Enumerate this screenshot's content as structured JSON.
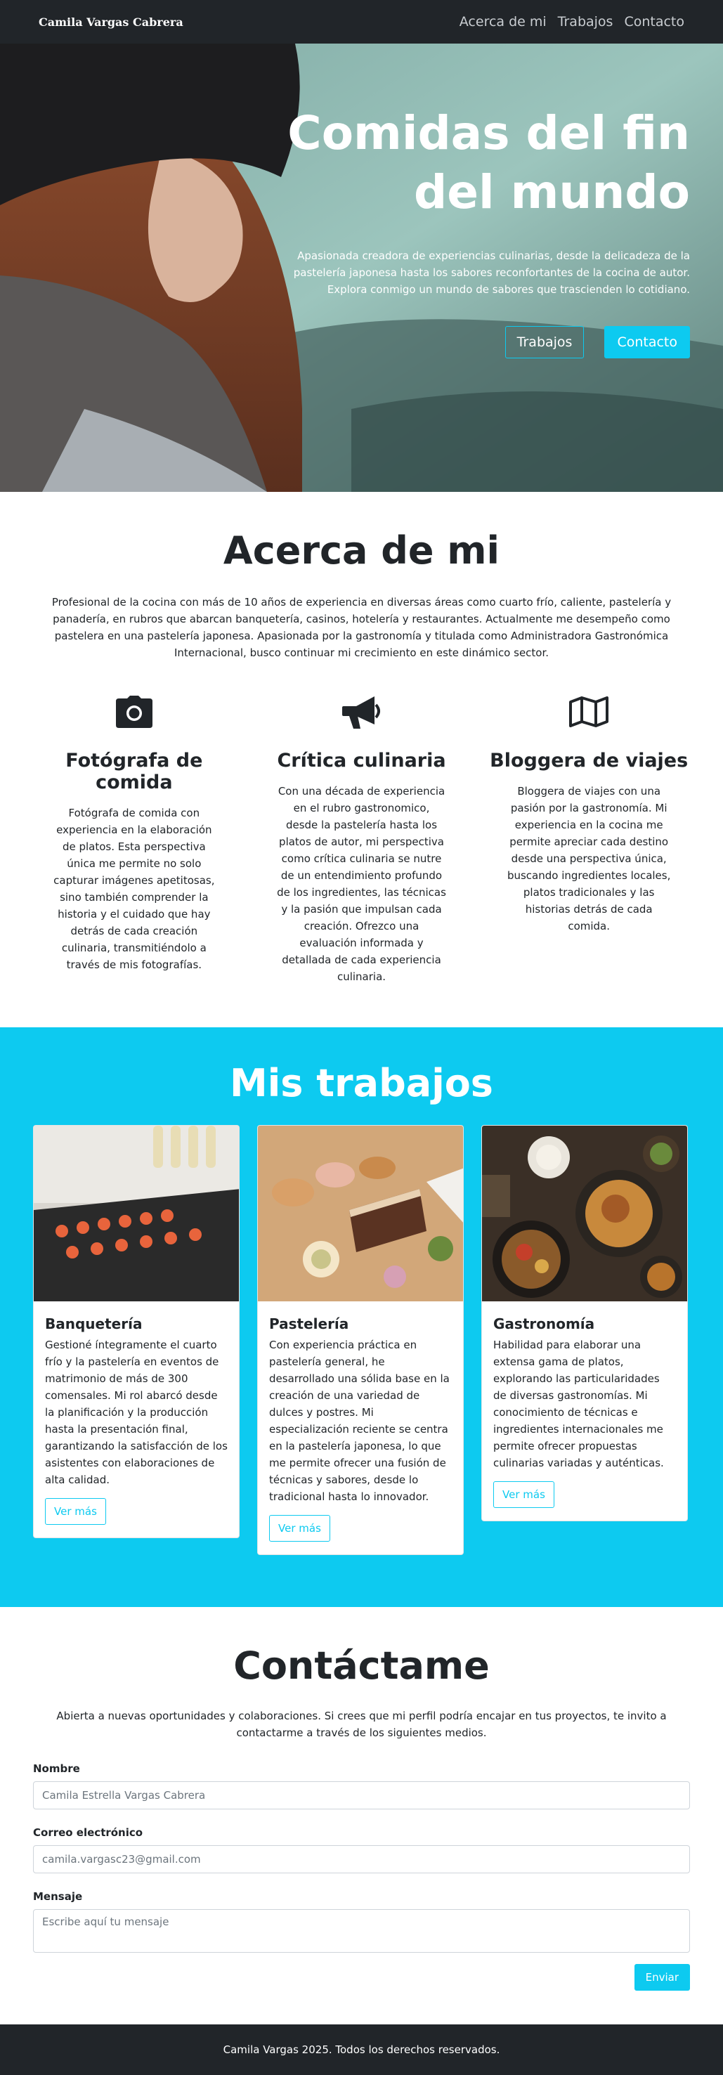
{
  "nav": {
    "brand": "Camila Vargas Cabrera",
    "links": [
      "Acerca de mi",
      "Trabajos",
      "Contacto"
    ]
  },
  "hero": {
    "title_line1": "Comidas del fin",
    "title_line2": "del mundo",
    "text": "Apasionada creadora de experiencias culinarias, desde la delicadeza de la pastelería japonesa hasta los sabores reconfortantes de la cocina de autor. Explora conmigo un mundo de sabores que trascienden lo cotidiano.",
    "btn_works": "Trabajos",
    "btn_contact": "Contacto"
  },
  "about": {
    "title": "Acerca de mi",
    "lead": "Profesional de la cocina con más de 10 años de experiencia en diversas áreas como cuarto frío, caliente, pastelería y panadería, en rubros que abarcan banquetería, casinos, hotelería y restaurantes. Actualmente me desempeño como pastelera en una pastelería japonesa. Apasionada por la gastronomía y titulada como Administradora Gastronómica Internacional, busco continuar mi crecimiento en este dinámico sector.",
    "features": [
      {
        "icon": "camera-icon",
        "title": "Fotógrafa de comida",
        "text": "Fotógrafa de comida con experiencia en la elaboración de platos. Esta perspectiva única me permite no solo capturar imágenes apetitosas, sino también comprender la historia y el cuidado que hay detrás de cada creación culinaria, transmitiéndolo a través de mis fotografías."
      },
      {
        "icon": "megaphone-icon",
        "title": "Crítica culinaria",
        "text": "Con una década de experiencia en el rubro gastronomico, desde la pastelería hasta los platos de autor, mi perspectiva como crítica culinaria se nutre de un entendimiento profundo de los ingredientes, las técnicas y la pasión que impulsan cada creación. Ofrezco una evaluación informada y detallada de cada experiencia culinaria."
      },
      {
        "icon": "map-icon",
        "title": "Bloggera de viajes",
        "text": "Bloggera de viajes con una pasión por la gastronomía. Mi experiencia en la cocina me permite apreciar cada destino desde una perspectiva única, buscando ingredientes locales, platos tradicionales y las historias detrás de cada comida."
      }
    ]
  },
  "works": {
    "title": "Mis trabajos",
    "cards": [
      {
        "title": "Banquetería",
        "text": "Gestioné íntegramente el cuarto frío y la pastelería en eventos de matrimonio de más de 300 comensales. Mi rol abarcó desde la planificación y la producción hasta la presentación final, garantizando la satisfacción de los asistentes con elaboraciones de alta calidad.",
        "button": "Ver más"
      },
      {
        "title": "Pastelería",
        "text": "Con experiencia práctica en pastelería general, he desarrollado una sólida base en la creación de una variedad de dulces y postres. Mi especialización reciente se centra en la pastelería japonesa, lo que me permite ofrecer una fusión de técnicas y sabores, desde lo tradicional hasta lo innovador.",
        "button": "Ver más"
      },
      {
        "title": "Gastronomía",
        "text": "Habilidad para elaborar una extensa gama de platos, explorando las particularidades de diversas gastronomías. Mi conocimiento de técnicas e ingredientes internacionales me permite ofrecer propuestas culinarias variadas y auténticas.",
        "button": "Ver más"
      }
    ]
  },
  "contact": {
    "title": "Contáctame",
    "lead": "Abierta a nuevas oportunidades y colaboraciones. Si crees que mi perfil podría encajar en tus proyectos, te invito a contactarme a través de los siguientes medios.",
    "name_label": "Nombre",
    "name_value": "Camila Estrella Vargas Cabrera",
    "email_label": "Correo electrónico",
    "email_value": "camila.vargasc23@gmail.com",
    "message_label": "Mensaje",
    "message_placeholder": "Escribe aquí tu mensaje",
    "submit": "Enviar"
  },
  "footer": {
    "text": "Camila Vargas 2025. Todos los derechos reservados."
  },
  "colors": {
    "accent": "#0dcaf0",
    "dark": "#212529"
  }
}
